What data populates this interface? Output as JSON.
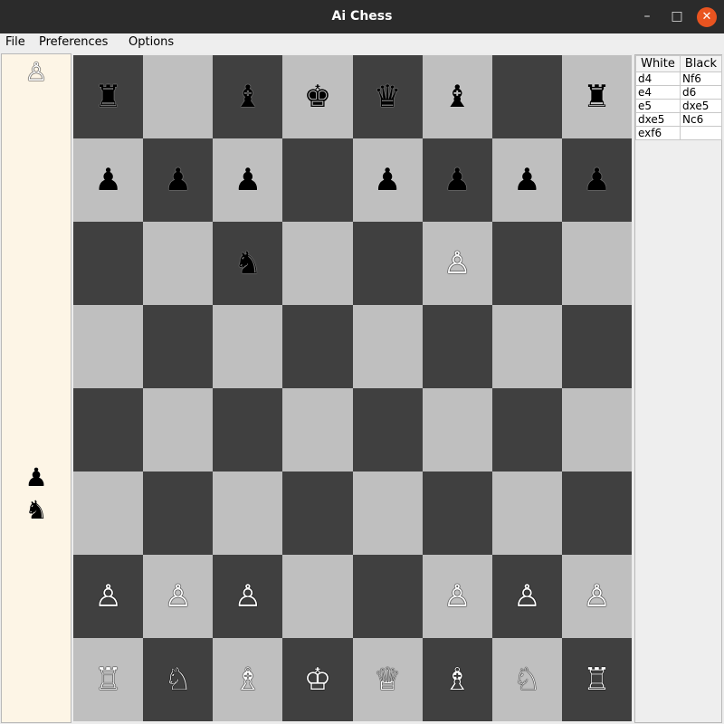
{
  "window": {
    "title": "Ai Chess",
    "minimize_glyph": "–",
    "maximize_glyph": "□",
    "close_glyph": "✕"
  },
  "menu": {
    "file": "File",
    "preferences": "Preferences",
    "options": "Options"
  },
  "captured": {
    "white": [
      "♙"
    ],
    "black": [
      "♟",
      "♞"
    ]
  },
  "board": [
    [
      "♜",
      "",
      "♝",
      "♚",
      "♛",
      "♝",
      "",
      "♜"
    ],
    [
      "♟",
      "♟",
      "♟",
      "",
      "♟",
      "♟",
      "♟",
      "♟"
    ],
    [
      "",
      "",
      "♞",
      "",
      "",
      "♙",
      "",
      ""
    ],
    [
      "",
      "",
      "",
      "",
      "",
      "",
      "",
      ""
    ],
    [
      "",
      "",
      "",
      "",
      "",
      "",
      "",
      ""
    ],
    [
      "",
      "",
      "",
      "",
      "",
      "",
      "",
      ""
    ],
    [
      "♙",
      "♙",
      "♙",
      "",
      "",
      "♙",
      "♙",
      "♙"
    ],
    [
      "♖",
      "♘",
      "♗",
      "♔",
      "♕",
      "♗",
      "♘",
      "♖"
    ]
  ],
  "moves": {
    "headers": [
      "White",
      "Black"
    ],
    "rows": [
      [
        "d4",
        "Nf6"
      ],
      [
        "e4",
        "d6"
      ],
      [
        "e5",
        "dxe5"
      ],
      [
        "dxe5",
        "Nc6"
      ],
      [
        "exf6",
        ""
      ]
    ]
  }
}
